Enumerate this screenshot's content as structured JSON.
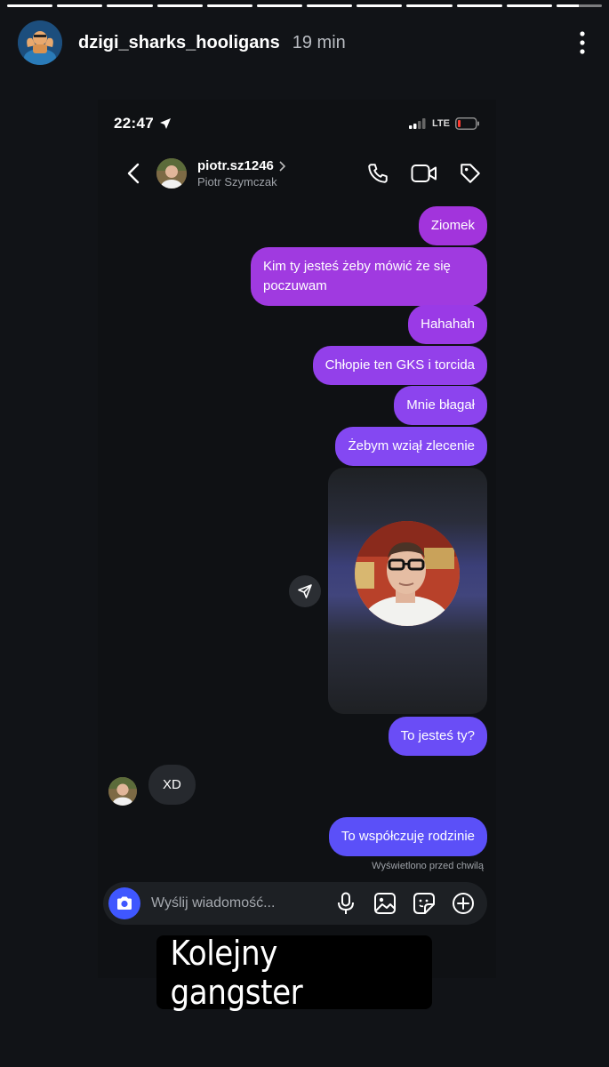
{
  "story": {
    "progress_segments": [
      1,
      1,
      1,
      1,
      1,
      1,
      1,
      1,
      1,
      1,
      1,
      0.5
    ],
    "username": "dzigi_sharks_hooligans",
    "time": "19 min",
    "caption": "Kolejny gangster"
  },
  "phone": {
    "time": "22:47",
    "network": "LTE"
  },
  "dm": {
    "username": "piotr.sz1246",
    "fullname": "Piotr Szymczak",
    "outgoing": [
      {
        "text": "Ziomek",
        "color": "#a234dc"
      },
      {
        "text": "Kim ty jesteś żeby mówić że się poczuwam",
        "color": "#a03ae0"
      },
      {
        "text": "Hahahah",
        "color": "#9a3ae6"
      },
      {
        "text": "Chłopie ten GKS i torcida",
        "color": "#9340ea"
      },
      {
        "text": "Mnie błagał",
        "color": "#8c44ee"
      },
      {
        "text": "Żebym wziął zlecenie",
        "color": "#8448f2"
      },
      {
        "text": "To jesteś ty?",
        "color": "#6a4df6"
      },
      {
        "text": "To współczuję rodzinie",
        "color": "#5b50f8"
      }
    ],
    "incoming": {
      "text": "XD"
    },
    "seen": "Wyświetlono przed chwilą",
    "composer_placeholder": "Wyślij wiadomość..."
  }
}
